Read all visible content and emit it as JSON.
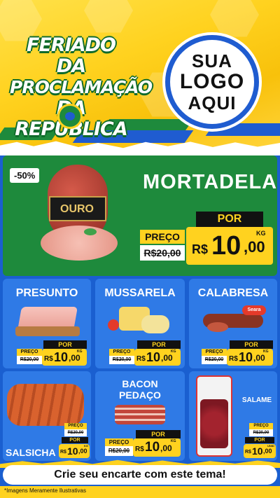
{
  "header": {
    "title_lines": [
      "FERIADO DA",
      "PROCLAMAÇÃO",
      "DA REPÚBLICA"
    ],
    "logo_lines": [
      "SUA",
      "LOGO",
      "AQUI"
    ]
  },
  "hero": {
    "product": "MORTADELA",
    "discount": "-50%",
    "brand": "OURO",
    "preco_label": "PREÇO",
    "old_price": "R$20,00",
    "por_label": "POR",
    "currency": "R$",
    "price_int": "10",
    "price_dec": ",00",
    "unit": "KG"
  },
  "tiles": [
    {
      "name": "PRESUNTO",
      "preco_label": "PREÇO",
      "old_price": "R$20,00",
      "por_label": "POR",
      "currency": "R$",
      "price_int": "10",
      "price_dec": ",00",
      "unit": "KG"
    },
    {
      "name": "MUSSARELA",
      "preco_label": "PREÇO",
      "old_price": "R$20,00",
      "por_label": "POR",
      "currency": "R$",
      "price_int": "10",
      "price_dec": ",00",
      "unit": "KG"
    },
    {
      "name": "CALABRESA",
      "brand": "Seara",
      "preco_label": "PREÇO",
      "old_price": "R$20,00",
      "por_label": "POR",
      "currency": "R$",
      "price_int": "10",
      "price_dec": ",00",
      "unit": "KG"
    },
    {
      "name": "SALSICHA",
      "preco_label": "PREÇO",
      "old_price": "R$20,00",
      "por_label": "POR",
      "currency": "R$",
      "price_int": "10",
      "price_dec": ",00",
      "unit": "KG"
    },
    {
      "name_lines": [
        "BACON",
        "PEDAÇO"
      ],
      "preco_label": "PREÇO",
      "old_price": "R$20,00",
      "por_label": "POR",
      "currency": "R$",
      "price_int": "10",
      "price_dec": ",00",
      "unit": "KG"
    },
    {
      "name": "SALAME",
      "preco_label": "PREÇO",
      "old_price": "R$20,00",
      "por_label": "POR",
      "currency": "R$",
      "price_int": "10",
      "price_dec": ",00",
      "unit": "UNID"
    }
  ],
  "cta": "Crie seu encarte com este tema!",
  "footnote": "*Imagens Meramente Ilustrativas",
  "colors": {
    "green": "#1e8a3c",
    "yellow": "#ffd21f",
    "blue": "#2f7ae6",
    "dark": "#111111"
  }
}
